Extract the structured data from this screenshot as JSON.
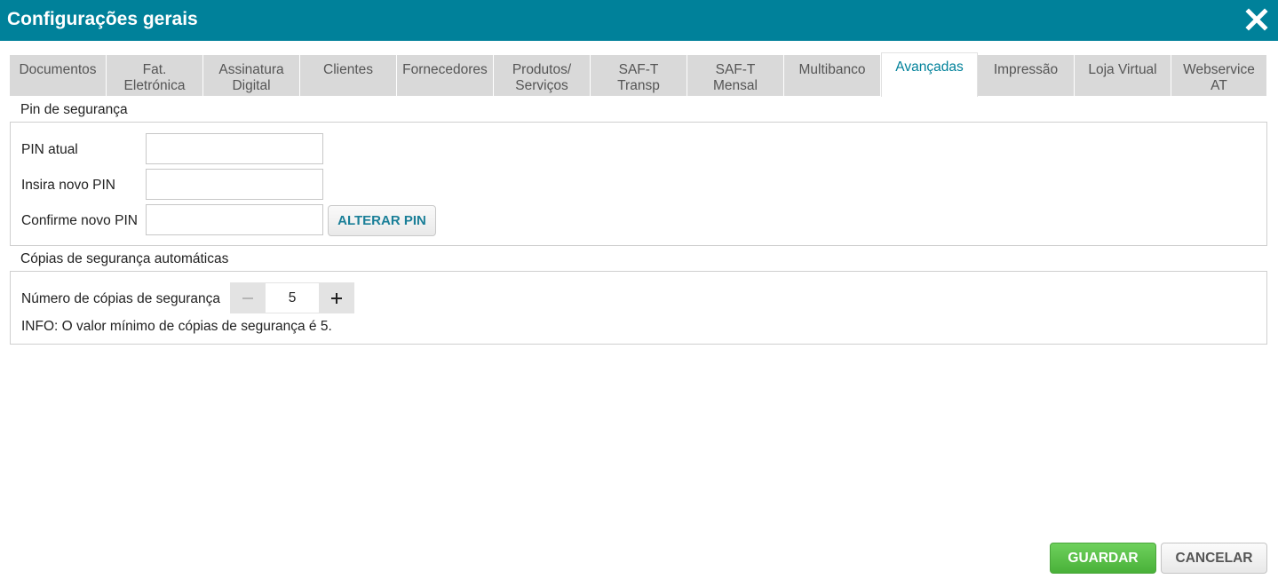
{
  "window": {
    "title": "Configurações gerais",
    "close_icon": "close-icon"
  },
  "tabs": [
    {
      "line1": "Documentos",
      "line2": ""
    },
    {
      "line1": "Fat.",
      "line2": "Eletrónica"
    },
    {
      "line1": "Assinatura",
      "line2": "Digital"
    },
    {
      "line1": "Clientes",
      "line2": ""
    },
    {
      "line1": "Fornecedores",
      "line2": ""
    },
    {
      "line1": "Produtos/",
      "line2": "Serviços"
    },
    {
      "line1": "SAF-T",
      "line2": "Transp"
    },
    {
      "line1": "SAF-T",
      "line2": "Mensal"
    },
    {
      "line1": "Multibanco",
      "line2": ""
    },
    {
      "line1": "Avançadas",
      "line2": ""
    },
    {
      "line1": "Impressão",
      "line2": ""
    },
    {
      "line1": "Loja Virtual",
      "line2": ""
    },
    {
      "line1": "Webservice",
      "line2": "AT"
    }
  ],
  "active_tab": "Avançadas",
  "pin_section": {
    "title": "Pin de segurança",
    "current_pin_label": "PIN atual",
    "current_pin_value": "",
    "new_pin_label": "Insira novo PIN",
    "new_pin_value": "",
    "confirm_pin_label": "Confirme novo PIN",
    "confirm_pin_value": "",
    "change_button": "ALTERAR PIN"
  },
  "backup_section": {
    "title": "Cópias de segurança automáticas",
    "copies_label": "Número de cópias de segurança",
    "copies_value": "5",
    "info": "INFO: O valor mínimo de cópias de segurança é 5."
  },
  "footer": {
    "save_button": "GUARDAR",
    "cancel_button": "CANCELAR"
  },
  "colors": {
    "header": "#00819a",
    "active_tab_text": "#00819a",
    "save_button": "#55bb45"
  }
}
